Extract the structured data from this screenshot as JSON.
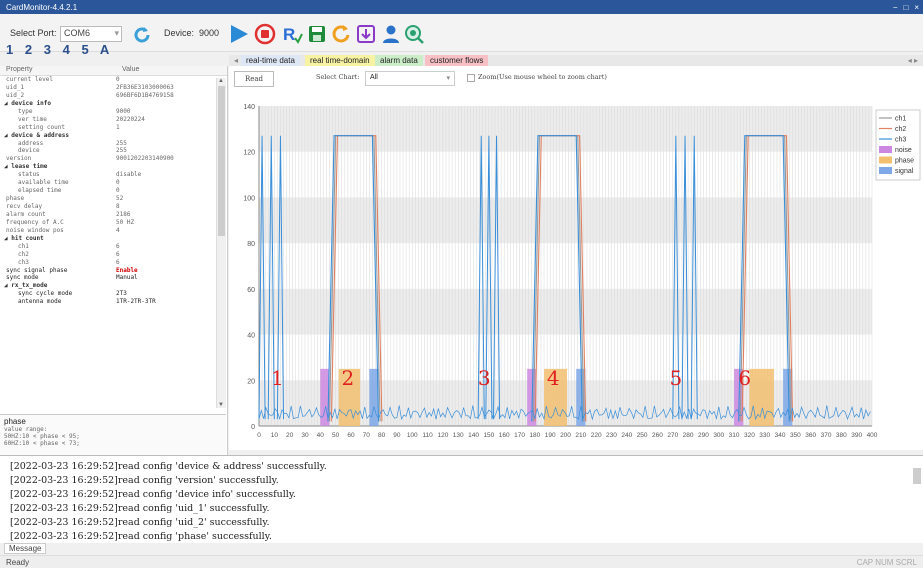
{
  "window": {
    "title": "CardMonitor-4.4.2.1",
    "min": "−",
    "max": "□",
    "close": "×"
  },
  "toolbar": {
    "port_label": "Select Port:",
    "port_value": "COM6",
    "device_label": "Device:",
    "device_value": "9000"
  },
  "numbers": [
    "1",
    "2",
    "3",
    "4",
    "5",
    "A"
  ],
  "properties": {
    "header": {
      "name": "Property",
      "value": "Value"
    },
    "rows": [
      {
        "name": "current level",
        "value": "0",
        "kind": "normal"
      },
      {
        "name": "uid_1",
        "value": "2FB36E3103000063",
        "kind": "normal"
      },
      {
        "name": "uid_2",
        "value": "696BF6D1B4769158",
        "kind": "normal"
      },
      {
        "name": "◢ device info",
        "value": "",
        "kind": "cat"
      },
      {
        "name": "type",
        "value": "9000",
        "kind": "sub"
      },
      {
        "name": "ver time",
        "value": "20220224",
        "kind": "sub"
      },
      {
        "name": "setting count",
        "value": "1",
        "kind": "sub"
      },
      {
        "name": "◢ device & address",
        "value": "",
        "kind": "cat"
      },
      {
        "name": "address",
        "value": "255",
        "kind": "sub"
      },
      {
        "name": "device",
        "value": "255",
        "kind": "sub"
      },
      {
        "name": "version",
        "value": "9001202203140900",
        "kind": "normal"
      },
      {
        "name": "◢ lease time",
        "value": "",
        "kind": "cat"
      },
      {
        "name": "status",
        "value": "disable",
        "kind": "sub"
      },
      {
        "name": "available time",
        "value": "0",
        "kind": "sub"
      },
      {
        "name": "elapsed time",
        "value": "0",
        "kind": "sub"
      },
      {
        "name": "phase",
        "value": "52",
        "kind": "normal"
      },
      {
        "name": "recv delay",
        "value": "8",
        "kind": "normal"
      },
      {
        "name": "alarm count",
        "value": "2186",
        "kind": "normal"
      },
      {
        "name": "frequency of A.C",
        "value": "50 HZ",
        "kind": "normal"
      },
      {
        "name": "noise window pos",
        "value": "4",
        "kind": "normal"
      },
      {
        "name": "◢ hit count",
        "value": "",
        "kind": "cat"
      },
      {
        "name": "ch1",
        "value": "6",
        "kind": "sub"
      },
      {
        "name": "ch2",
        "value": "6",
        "kind": "sub"
      },
      {
        "name": "ch3",
        "value": "6",
        "kind": "sub"
      },
      {
        "name": "sync signal phase",
        "value": "Enable",
        "kind": "hl"
      },
      {
        "name": "sync mode",
        "value": "Manual",
        "kind": "dark"
      },
      {
        "name": "◢ rx_tx_mode",
        "value": "",
        "kind": "cat"
      },
      {
        "name": "sync cycle mode",
        "value": "2T3",
        "kind": "subdark"
      },
      {
        "name": "antenna mode",
        "value": "1TR-2TR-3TR",
        "kind": "subdark"
      }
    ],
    "desc_title": "phase",
    "desc_lines": [
      "value range:",
      "50HZ:10 < phase < 95;",
      "60HZ:10 < phase < 73;"
    ]
  },
  "tabs": [
    {
      "label": "real-time data",
      "color": "#dde7f5"
    },
    {
      "label": "real time-domain",
      "color": "#f7f3a3"
    },
    {
      "label": "alarm data",
      "color": "#cbeec8"
    },
    {
      "label": "customer flows",
      "color": "#f6c0c5"
    }
  ],
  "tab_nav": {
    "left": "◂",
    "right": "◂ ▸"
  },
  "chart_controls": {
    "read_label": "Read",
    "select_label": "Select Chart:",
    "select_value": "All",
    "zoom_label": "Zoom(Use mouse wheel to zoom chart)"
  },
  "log_lines": [
    "[2022-03-23 16:29:52]read config 'device & address' successfully.",
    "[2022-03-23 16:29:52]read config 'version' successfully.",
    "[2022-03-23 16:29:52]read config 'device info' successfully.",
    "[2022-03-23 16:29:52]read config 'uid_1' successfully.",
    "[2022-03-23 16:29:52]read config 'uid_2' successfully.",
    "[2022-03-23 16:29:52]read config 'phase' successfully."
  ],
  "message_tab": "Message",
  "status": {
    "left": "Ready",
    "right": "CAP NUM SCRL"
  },
  "chart_data": {
    "type": "line",
    "xlim": [
      0,
      400
    ],
    "ylim": [
      0,
      140
    ],
    "x_ticks": [
      0,
      10,
      20,
      30,
      40,
      50,
      60,
      70,
      80,
      90,
      100,
      110,
      120,
      130,
      140,
      150,
      160,
      170,
      180,
      190,
      200,
      210,
      220,
      230,
      240,
      250,
      260,
      270,
      280,
      290,
      300,
      310,
      320,
      330,
      340,
      350,
      360,
      370,
      380,
      390,
      400
    ],
    "y_ticks": [
      0,
      20,
      40,
      60,
      80,
      100,
      120,
      140
    ],
    "legend": [
      "ch1",
      "ch2",
      "ch3",
      "noise",
      "phase",
      "signal"
    ],
    "legend_colors": [
      "#999999",
      "#e08060",
      "#3a8fd9",
      "#cc88e0",
      "#f2c070",
      "#7ea8e8"
    ],
    "markers": [
      "1",
      "2",
      "3",
      "4",
      "5",
      "6"
    ],
    "marker_x": [
      12,
      58,
      147,
      192,
      272,
      317
    ],
    "pulses": [
      [
        50,
        75
      ],
      [
        183,
        208
      ],
      [
        318,
        343
      ]
    ],
    "noise_bars": [
      [
        40,
        46
      ],
      [
        175,
        181
      ],
      [
        310,
        316
      ]
    ],
    "phase_bars": [
      [
        52,
        66
      ],
      [
        186,
        201
      ],
      [
        320,
        336
      ]
    ],
    "signal_bars": [
      [
        72,
        78
      ],
      [
        207,
        213
      ],
      [
        342,
        348
      ]
    ],
    "bar_height": 25,
    "spike_groups": [
      [
        2,
        8,
        14
      ],
      [
        145,
        150,
        155
      ],
      [
        272,
        278,
        284
      ]
    ]
  }
}
